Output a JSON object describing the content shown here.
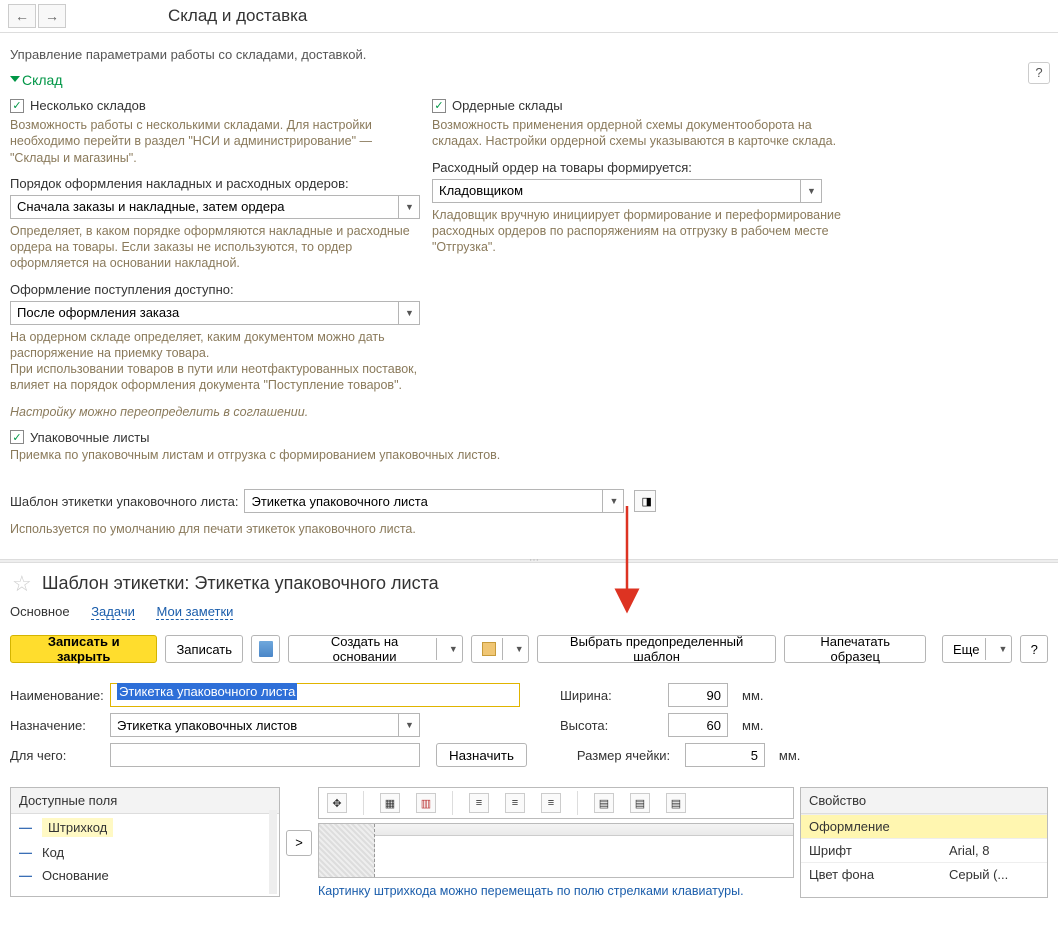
{
  "header": {
    "title": "Склад и доставка",
    "subtitle": "Управление параметрами работы со складами, доставкой.",
    "help": "?"
  },
  "section": {
    "title": "Склад"
  },
  "left": {
    "chk1_label": "Несколько складов",
    "chk1_desc": "Возможность работы с несколькими складами. Для настройки необходимо перейти в раздел \"НСИ и администрирование\" — \"Склады и магазины\".",
    "f1_label": "Порядок оформления накладных и расходных ордеров:",
    "f1_value": "Сначала заказы и накладные, затем ордера",
    "f1_desc": "Определяет, в каком порядке оформляются накладные и расходные ордера на товары. Если заказы не используются, то ордер оформляется на основании накладной.",
    "f2_label": "Оформление поступления доступно:",
    "f2_value": "После оформления заказа",
    "f2_desc": "На ордерном складе определяет, каким документом можно дать распоряжение на приемку товара.\nПри использовании товаров в пути или неотфактурованных поставок, влияет на порядок оформления документа \"Поступление товаров\".",
    "f2_desc_i": "Настройку можно переопределить в соглашении.",
    "chk2_label": "Упаковочные листы",
    "chk2_desc": "Приемка по упаковочным листам и отгрузка с формированием упаковочных листов.",
    "tpl_label": "Шаблон этикетки упаковочного листа:",
    "tpl_value": "Этикетка упаковочного листа",
    "tpl_desc": "Используется по умолчанию для печати этикеток упаковочного листа."
  },
  "right": {
    "chk1_label": "Ордерные склады",
    "chk1_desc": "Возможность применения ордерной схемы документооборота на складах. Настройки ордерной схемы указываются в карточке склада.",
    "f1_label": "Расходный ордер на товары формируется:",
    "f1_value": "Кладовщиком",
    "f1_desc": "Кладовщик вручную инициирует формирование и переформирование расходных ордеров по распоряжениям на отгрузку в рабочем месте \"Отгрузка\"."
  },
  "editor": {
    "title": "Шаблон этикетки: Этикетка упаковочного листа",
    "tabs": {
      "main": "Основное",
      "tasks": "Задачи",
      "notes": "Мои заметки"
    },
    "toolbar": {
      "save_close": "Записать и закрыть",
      "save": "Записать",
      "create_based": "Создать на основании",
      "select_tpl": "Выбрать предопределенный шаблон",
      "print": "Напечатать образец",
      "more": "Еще"
    },
    "form": {
      "name_label": "Наименование:",
      "name_value": "Этикетка упаковочного листа",
      "assign_label": "Назначение:",
      "assign_value": "Этикетка упаковочных листов",
      "for_label": "Для чего:",
      "assign_btn": "Назначить",
      "width_label": "Ширина:",
      "width_value": "90",
      "width_unit": "мм.",
      "height_label": "Высота:",
      "height_value": "60",
      "height_unit": "мм.",
      "cell_label": "Размер ячейки:",
      "cell_value": "5",
      "cell_unit": "мм."
    },
    "fields": {
      "header": "Доступные поля",
      "items": [
        "Штрихкод",
        "Код",
        "Основание"
      ]
    },
    "hint": "Картинку штрихкода можно перемещать по полю стрелками клавиатуры.",
    "props": {
      "col1": "Свойство",
      "rows": [
        {
          "k": "Оформление",
          "v": ""
        },
        {
          "k": "Шрифт",
          "v": "Arial, 8"
        },
        {
          "k": "Цвет фона",
          "v": "Серый (..."
        }
      ]
    }
  }
}
